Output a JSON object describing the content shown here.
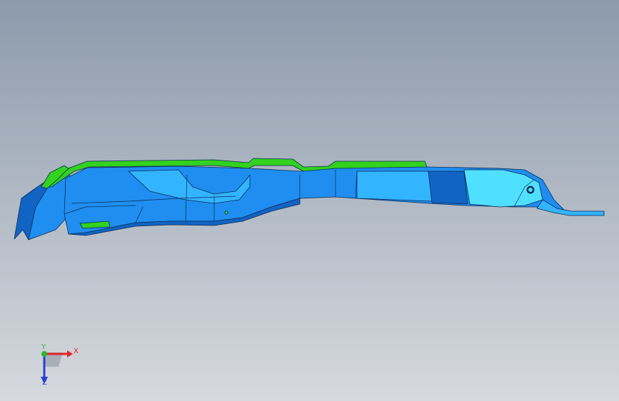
{
  "viewport": {
    "background_top": "#8c9aab",
    "background_bottom": "#d6d9de"
  },
  "model": {
    "primary_color": "#1f8ef0",
    "shadow_color": "#1164c4",
    "highlight_color": "#33b4ff",
    "cyan_color": "#4fe0ff",
    "green_color": "#32d21e",
    "edge_color": "#0b2a55"
  },
  "triad": {
    "x_label": "X",
    "y_label": "Y",
    "z_label": "Z",
    "x_color": "#e0262b",
    "y_color": "#28b83a",
    "z_color": "#2a3fd1"
  }
}
